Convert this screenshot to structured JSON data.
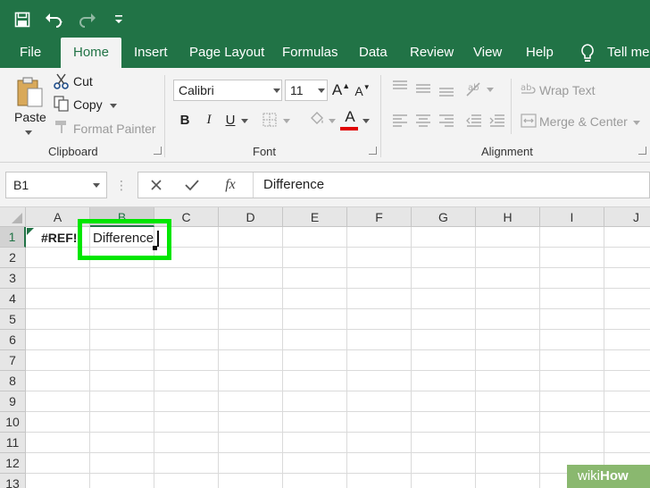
{
  "quick_access": {
    "icons": [
      "save-icon",
      "undo-icon",
      "redo-icon",
      "customize-icon"
    ]
  },
  "tabs": [
    "File",
    "Home",
    "Insert",
    "Page Layout",
    "Formulas",
    "Data",
    "Review",
    "View",
    "Help",
    "Tell me w"
  ],
  "active_tab": "Home",
  "ribbon": {
    "clipboard": {
      "paste": "Paste",
      "cut": "Cut",
      "copy": "Copy",
      "format_painter": "Format Painter",
      "label": "Clipboard"
    },
    "font": {
      "font_name": "Calibri",
      "font_size": "11",
      "bold": "B",
      "italic": "I",
      "underline": "U",
      "font_color_letter": "A",
      "label": "Font",
      "font_color": "#e00000"
    },
    "alignment": {
      "wrap_text": "Wrap Text",
      "merge_center": "Merge & Center",
      "label": "Alignment"
    }
  },
  "formula_bar": {
    "name_box": "B1",
    "fx": "fx",
    "value": "Difference"
  },
  "grid": {
    "columns": [
      "A",
      "B",
      "C",
      "D",
      "E",
      "F",
      "G",
      "H",
      "I",
      "J"
    ],
    "rows": [
      "1",
      "2",
      "3",
      "4",
      "5",
      "6",
      "7",
      "8",
      "9",
      "10",
      "11",
      "12",
      "13"
    ],
    "selected_column": "B",
    "selected_row": "1",
    "cells": {
      "A1": "#REF!",
      "B1": "Difference"
    }
  },
  "colors": {
    "excel_green": "#217346",
    "highlight_green": "#00e600"
  },
  "watermark": {
    "wiki": "wiki",
    "how": "How"
  }
}
